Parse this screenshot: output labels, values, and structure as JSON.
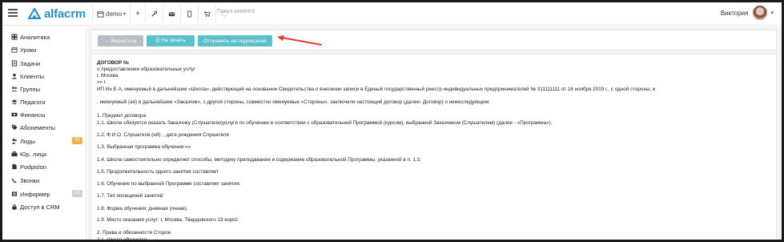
{
  "brand": {
    "name": "alfacrm"
  },
  "toolbar": {
    "branch": "demo",
    "search_placeholder": "Поиск клиента",
    "user_name": "Виктория"
  },
  "sidebar": {
    "items": [
      {
        "label": "Аналитика",
        "icon": "analytics-icon"
      },
      {
        "label": "Уроки",
        "icon": "calendar-icon"
      },
      {
        "label": "Задачи",
        "icon": "tasks-icon"
      },
      {
        "label": "Клиенты",
        "icon": "client-icon"
      },
      {
        "label": "Группы",
        "icon": "group-icon"
      },
      {
        "label": "Педагоги",
        "icon": "teacher-icon"
      },
      {
        "label": "Финансы",
        "icon": "finance-icon"
      },
      {
        "label": "Абонементы",
        "icon": "tag-icon"
      },
      {
        "label": "Лиды",
        "icon": "leads-icon",
        "badge": "32",
        "badge_color": "#f0ad4e"
      },
      {
        "label": "Юр. лица",
        "icon": "briefcase-icon"
      },
      {
        "label": "Podpislon",
        "icon": "document-icon"
      },
      {
        "label": "Звонки",
        "icon": "phone-icon"
      },
      {
        "label": "Информер",
        "icon": "informer-icon",
        "badge": "10",
        "badge_color": "#c7d3dc"
      },
      {
        "label": "Доступ в CRM",
        "icon": "lock-icon"
      }
    ]
  },
  "actions": {
    "back": "← Вернуться",
    "print": "⎙ На печать",
    "send": "Отправить на подписание"
  },
  "colors": {
    "accent": "#2c8fc7",
    "teal": "#5bc0c9",
    "gray_btn": "#b9bec4",
    "arrow": "#e53935"
  },
  "document": {
    "lines": [
      "ДОГОВОР №",
      "о предоставлении образовательных услуг",
      "г. Москва",
      "«»  г.",
      "ИП Ин Е А, именуемый в дальнейшем «Школа», действующий на основании Свидетельства о внесении записи в Единый государственный реестр индивидуальных предпринимателей № 311111111 от 18 ноября 2019 г., с одной стороны, и",
      ", именуемый (ая) в дальнейшем «Заказчик», с другой стороны, совместно именуемые «Стороны», заключили настоящий договор (далее- Договор) о нижеследующем:",
      "1. Предмет договора:",
      "1.1. Школа обязуется оказать Заказчику (Слушателю)услуги по обучению в соответствии с образовательной Программой (курсом), выбранной Заказчиком (Слушателем) (далее - «Программа»).",
      "1.2. Ф.И.О. Слушателя (ей): , дата рождения Слушателя",
      "1.3. Выбранная программа обучения:«».",
      "1.4. Школа самостоятельно определяет способы, методику преподавания и содержание образовательной Программы, указанной в п. 1.3.",
      "1.5. Продолжительность одного занятия составляет",
      "1.6. Обучение по выбранной Программе составляет занятия.",
      "1.7. Тип посещений занятий:",
      "1.8. Форма обучения: дневная (очная).",
      "1.9. Место оказания услуг: г. Москва, Твардовского 18 корп2",
      "2. Права и обязанности Сторон",
      "2.1. Школа обязуется:"
    ]
  }
}
